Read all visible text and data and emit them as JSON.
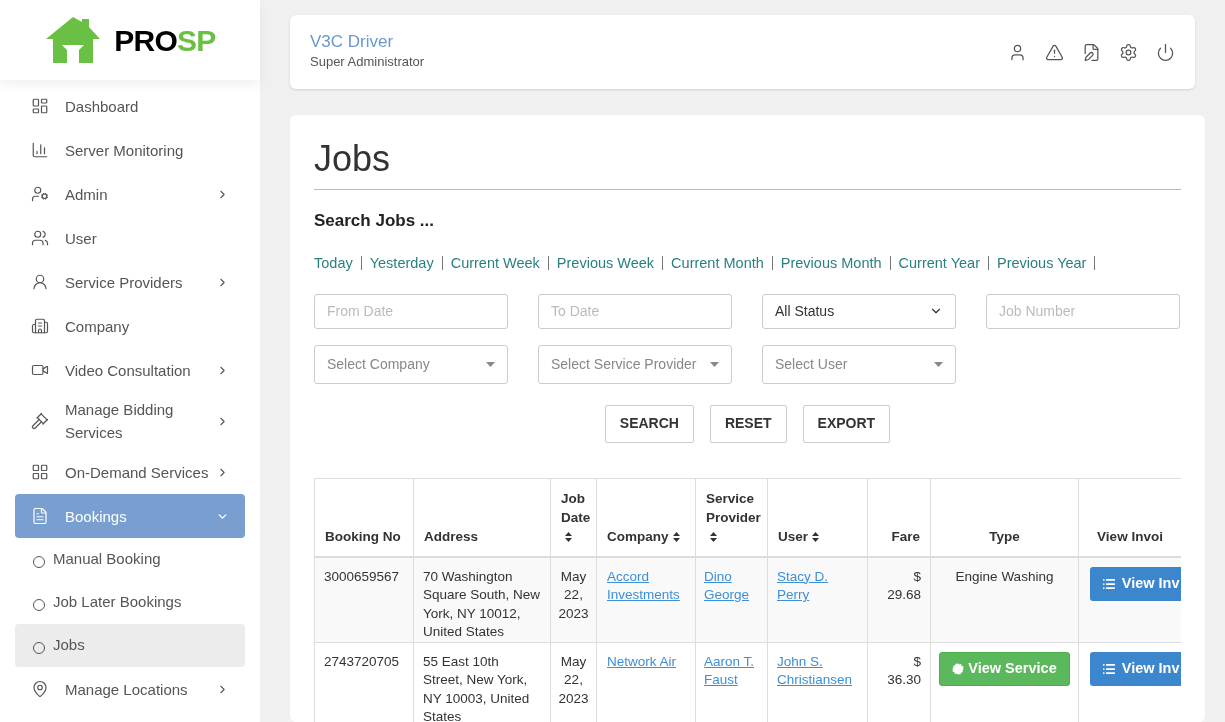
{
  "logo": {
    "part_1": "PRO",
    "part_2": "SP"
  },
  "sidebar": {
    "items": [
      {
        "label": "Dashboard",
        "expandable": false,
        "selected": false
      },
      {
        "label": "Server Monitoring",
        "expandable": false,
        "selected": false
      },
      {
        "label": "Admin",
        "expandable": true,
        "selected": false
      },
      {
        "label": "User",
        "expandable": false,
        "selected": false
      },
      {
        "label": "Service Providers",
        "expandable": true,
        "selected": false
      },
      {
        "label": "Company",
        "expandable": false,
        "selected": false
      },
      {
        "label": "Video Consultation",
        "expandable": true,
        "selected": false
      },
      {
        "label": "Manage Bidding Services",
        "expandable": true,
        "selected": false
      },
      {
        "label": "On-Demand Services",
        "expandable": true,
        "selected": false
      },
      {
        "label": "Bookings",
        "expandable": true,
        "selected": true,
        "expanded": true,
        "children": [
          {
            "label": "Manual Booking",
            "selected": false
          },
          {
            "label": "Job Later Bookings",
            "selected": false
          },
          {
            "label": "Jobs",
            "selected": true
          }
        ]
      },
      {
        "label": "Manage Locations",
        "expandable": true,
        "selected": false
      }
    ]
  },
  "header": {
    "name": "V3C Driver",
    "role": "Super Administrator"
  },
  "page": {
    "title": "Jobs",
    "search_heading": "Search Jobs ...",
    "quick_ranges": [
      "Today",
      "Yesterday",
      "Current Week",
      "Previous Week",
      "Current Month",
      "Previous Month",
      "Current Year",
      "Previous Year"
    ],
    "filters": [
      {
        "kind": "input",
        "placeholder": "From Date"
      },
      {
        "kind": "input",
        "placeholder": "To Date"
      },
      {
        "kind": "select",
        "value": "All Status"
      },
      {
        "kind": "input",
        "placeholder": "Job Number"
      },
      {
        "kind": "combo",
        "placeholder": "Select Company"
      },
      {
        "kind": "combo",
        "placeholder": "Select Service Provider"
      },
      {
        "kind": "combo",
        "placeholder": "Select User"
      }
    ],
    "buttons": [
      "SEARCH",
      "RESET",
      "EXPORT"
    ]
  },
  "table": {
    "columns": [
      {
        "label": "Booking No",
        "sortable": false
      },
      {
        "label": "Address",
        "sortable": false
      },
      {
        "label": "Job Date",
        "sortable": true
      },
      {
        "label": "Company",
        "sortable": true
      },
      {
        "label": "Service Provider",
        "sortable": true
      },
      {
        "label": "User",
        "sortable": true
      },
      {
        "label": "Fare",
        "sortable": false
      },
      {
        "label": "Type",
        "sortable": false
      },
      {
        "label": "View Invoi",
        "sortable": false
      }
    ],
    "rows": [
      {
        "booking_no": "3000659567",
        "address": "70 Washington Square South, New York, NY 10012, United States",
        "job_date": "May 22, 2023",
        "company": "Accord Investments",
        "service_provider": "Dino George",
        "user": "Stacy D. Perry",
        "fare": "$ 29.68",
        "type": {
          "kind": "text",
          "text": "Engine Washing"
        },
        "invoice": "View Inv"
      },
      {
        "booking_no": "2743720705",
        "address": "55 East 10th Street, New York, NY 10003, United States",
        "job_date": "May 22, 2023",
        "company": "Network Air",
        "service_provider": "Aaron T. Faust",
        "user": "John S. Christiansen",
        "fare": "$ 36.30",
        "type": {
          "kind": "button",
          "text": "View Service"
        },
        "invoice": "View Inv"
      }
    ]
  }
}
